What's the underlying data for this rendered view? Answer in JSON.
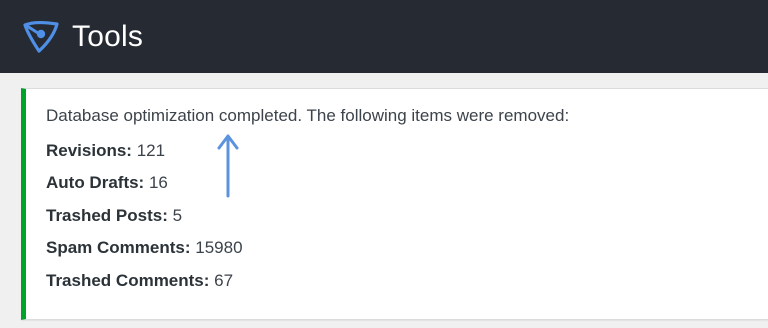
{
  "header": {
    "title": "Tools",
    "logo_icon": "yoast-style-logo-icon",
    "background": "#262a33",
    "logo_color": "#4f8fe6"
  },
  "notice": {
    "status_color": "#00a32a",
    "message": "Database optimization completed. The following items were removed:",
    "items": [
      {
        "label": "Revisions:",
        "value": "121"
      },
      {
        "label": "Auto Drafts:",
        "value": "16"
      },
      {
        "label": "Trashed Posts:",
        "value": "5"
      },
      {
        "label": "Spam Comments:",
        "value": "15980"
      },
      {
        "label": "Trashed Comments:",
        "value": "67"
      }
    ]
  },
  "annotation": {
    "icon": "arrow-up-icon",
    "color": "#5b93dc"
  }
}
